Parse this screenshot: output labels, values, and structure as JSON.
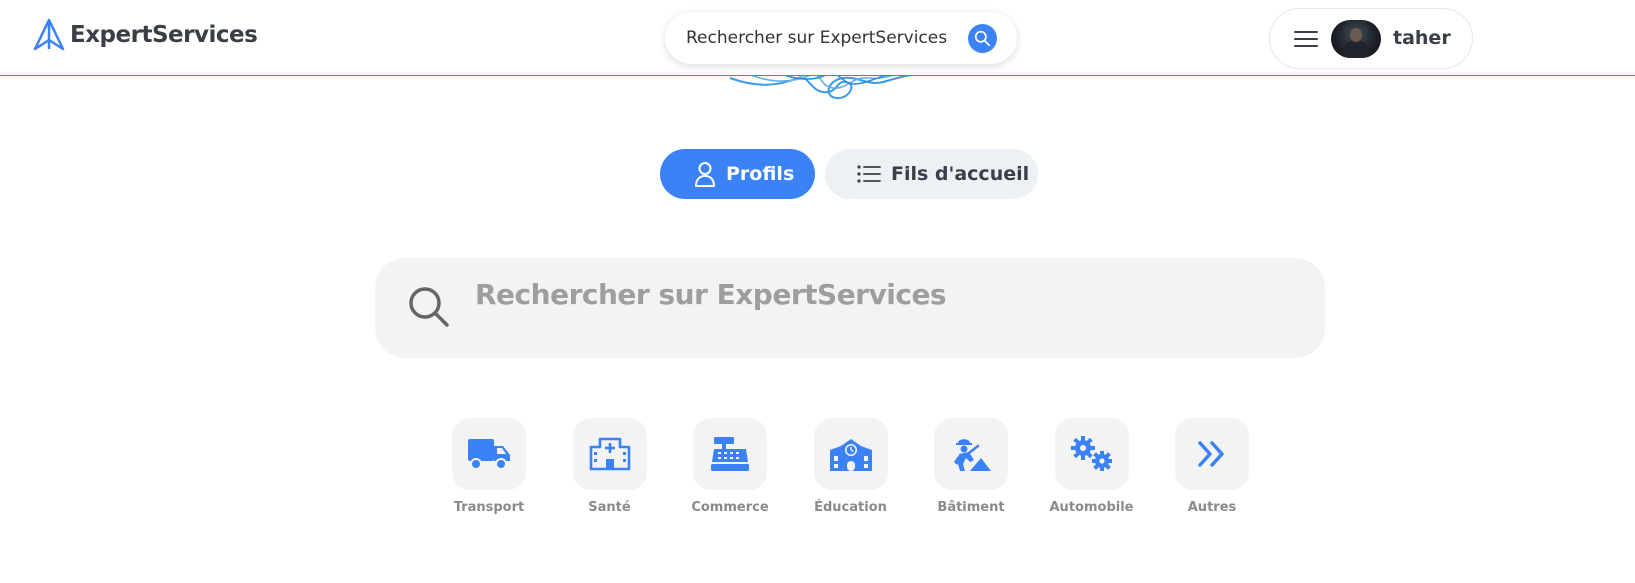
{
  "header": {
    "brand": "ExpertServices",
    "search_placeholder": "Rechercher sur ExpertServices",
    "user_name": "taher"
  },
  "tabs": [
    {
      "label": "Profils",
      "active": true
    },
    {
      "label": "Fils d'accueil",
      "active": false
    }
  ],
  "main_search": {
    "placeholder": "Rechercher sur ExpertServices"
  },
  "categories": [
    {
      "label": "Transport",
      "icon": "truck-icon"
    },
    {
      "label": "Santé",
      "icon": "hospital-icon"
    },
    {
      "label": "Commerce",
      "icon": "cash-register-icon"
    },
    {
      "label": "Éducation",
      "icon": "school-icon"
    },
    {
      "label": "Bâtiment",
      "icon": "construction-worker-icon"
    },
    {
      "label": "Automobile",
      "icon": "gears-icon"
    },
    {
      "label": "Autres",
      "icon": "double-chevron-right-icon"
    }
  ],
  "colors": {
    "accent": "#3b82f6",
    "tab_inactive_bg": "#edf0f4",
    "search_bg": "#f3f3f3",
    "category_label": "#8a8a8a"
  }
}
